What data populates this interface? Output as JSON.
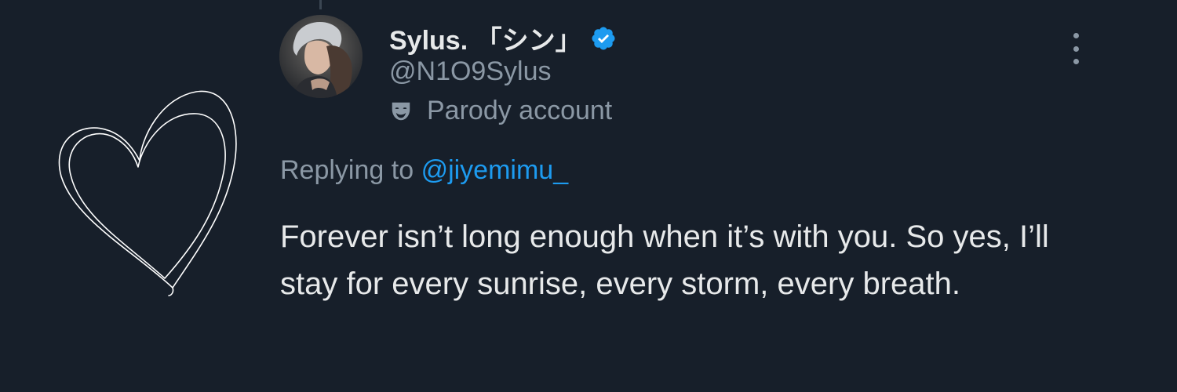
{
  "tweet": {
    "author": {
      "display_name": "Sylus. 「シン」",
      "handle": "@N1O9Sylus",
      "verified": true,
      "account_label": "Parody account",
      "account_label_icon": "parody-mask-icon",
      "avatar_icon": "profile-avatar"
    },
    "reply": {
      "prefix": "Replying to",
      "mention": "@jiyemimu_"
    },
    "text": "Forever isn’t long enough when it’s with you. So yes, I’ll stay for every sunrise, every storm, every breath.",
    "menu_icon": "more-options-icon"
  },
  "colors": {
    "background": "#171f2a",
    "primary_text": "#e7e9ea",
    "secondary_text": "#8b98a5",
    "accent": "#1d9bf0",
    "verified_badge": "#1d9bf0",
    "doodle": "#ffffff"
  },
  "decoration": {
    "icon": "heart-doodle-icon"
  }
}
